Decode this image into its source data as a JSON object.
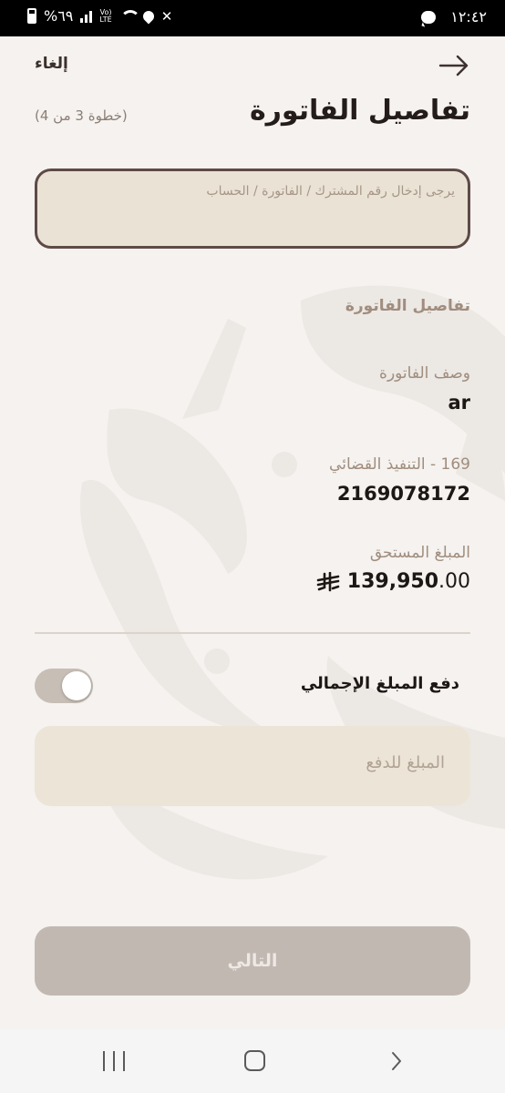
{
  "status_bar": {
    "time": "١٢:٤٢",
    "battery": "%٦٩"
  },
  "header": {
    "cancel_label": "إلغاء",
    "title": "تفاصيل الفاتورة",
    "step": "(خطوة 3 من 4)"
  },
  "account_field": {
    "placeholder": "يرجى إدخال رقم المشترك / الفاتورة / الحساب",
    "value": ""
  },
  "invoice_details": {
    "section_title": "تفاصيل الفاتورة",
    "description_label": "وصف الفاتورة",
    "description_value": "ar",
    "biller_label": "169 - التنفيذ القضائي",
    "biller_value": "2169078172",
    "amount_due_label": "المبلغ المستحق",
    "amount_due_integer": "139,950",
    "amount_due_decimal": ".00",
    "currency_icon": "saudi-riyal-icon"
  },
  "pay_total": {
    "label": "دفع المبلغ الإجمالي",
    "toggle_on": true
  },
  "payment_amount_field": {
    "placeholder": "المبلغ للدفع",
    "value": ""
  },
  "next_button": {
    "label": "التالي",
    "enabled": false
  },
  "colors": {
    "background": "#f5f2ef",
    "field_fill": "#ebe2d6",
    "field_border": "#5e4a45",
    "label_muted": "#a08d7e",
    "button_disabled": "#c2b8b2"
  }
}
